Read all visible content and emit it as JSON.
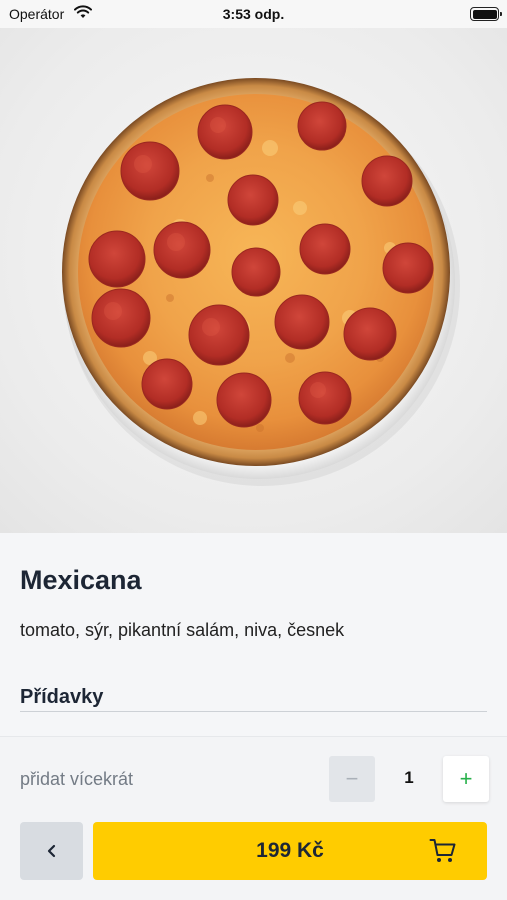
{
  "status_bar": {
    "carrier": "Operátor",
    "time": "3:53 odp.",
    "icons": [
      "wifi-icon",
      "battery-icon"
    ]
  },
  "product": {
    "image": "pepperoni-pizza-photo",
    "name": "Mexicana",
    "ingredients": "tomato, sýr, pikantní salám, niva, česnek"
  },
  "extras": {
    "title": "Přídavky"
  },
  "quantity": {
    "label": "přidat vícekrát",
    "minus": "−",
    "value": "1",
    "plus": "+"
  },
  "actions": {
    "back_icon": "chevron-left-icon",
    "price": "199 Kč",
    "cart_icon": "cart-icon"
  },
  "colors": {
    "accent": "#ffcc00",
    "plus": "#26b04a",
    "text": "#1d2635"
  }
}
